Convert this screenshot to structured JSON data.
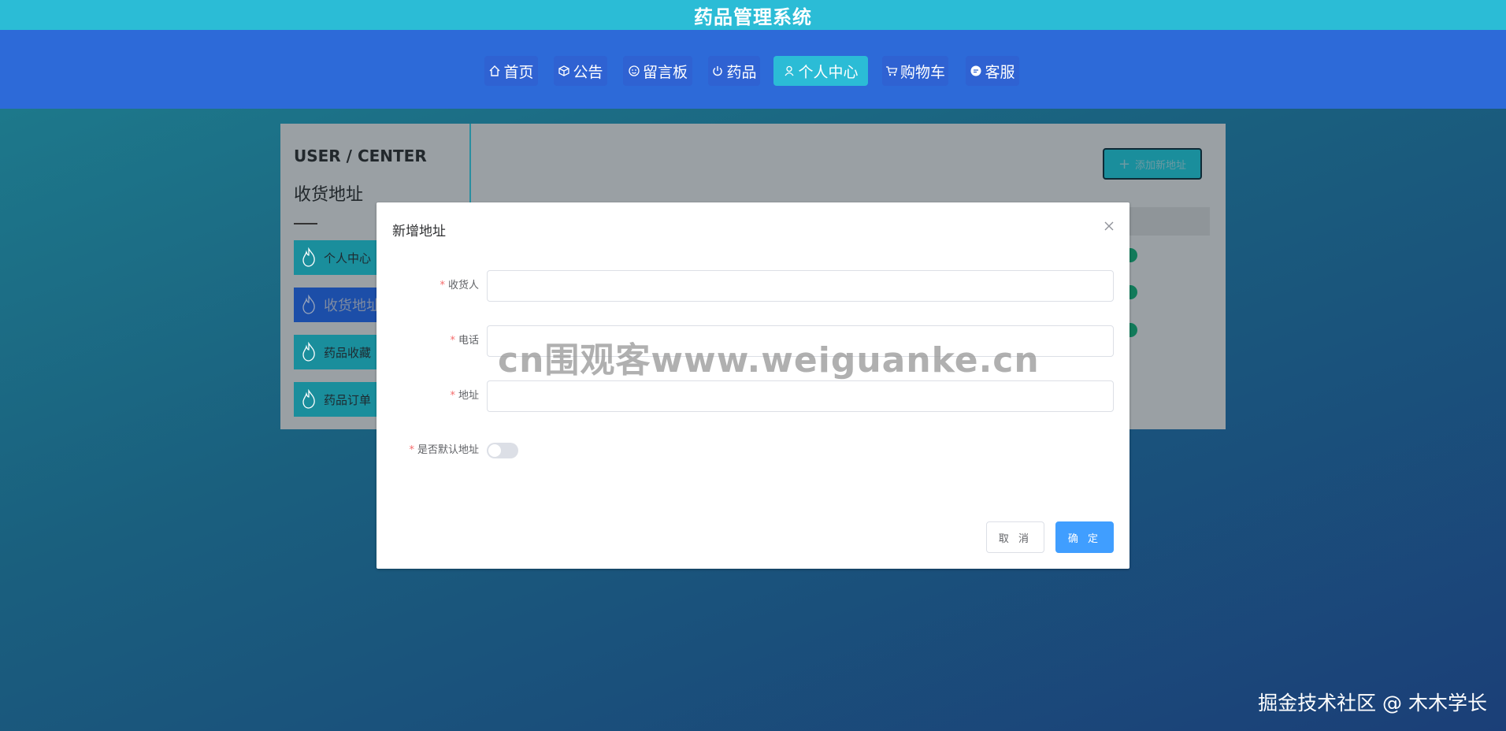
{
  "app": {
    "title": "药品管理系统"
  },
  "nav": {
    "items": [
      {
        "label": "首页",
        "icon": "home-icon"
      },
      {
        "label": "公告",
        "icon": "box-icon"
      },
      {
        "label": "留言板",
        "icon": "smile-icon"
      },
      {
        "label": "药品",
        "icon": "power-icon"
      },
      {
        "label": "个人中心",
        "icon": "user-icon",
        "active": true
      },
      {
        "label": "购物车",
        "icon": "cart-icon"
      },
      {
        "label": "客服",
        "icon": "chat-icon"
      }
    ]
  },
  "sidebar": {
    "heading": "USER / CENTER",
    "subheading": "收货地址",
    "items": [
      {
        "label": "个人中心",
        "icon": "fire-icon"
      },
      {
        "label": "收货地址",
        "icon": "fire-icon",
        "selected": true
      },
      {
        "label": "药品收藏",
        "icon": "fire-icon"
      },
      {
        "label": "药品订单",
        "icon": "fire-icon"
      }
    ]
  },
  "content": {
    "add_button": "添加新地址"
  },
  "dialog": {
    "title": "新增地址",
    "fields": [
      {
        "label": "收货人",
        "value": "",
        "required": true
      },
      {
        "label": "电话",
        "value": "",
        "required": true
      },
      {
        "label": "地址",
        "value": "",
        "required": true
      },
      {
        "label": "是否默认地址",
        "type": "switch",
        "on": false,
        "required": true
      }
    ],
    "required_mark": "*",
    "cancel_label": "取 消",
    "confirm_label": "确 定"
  },
  "watermark": "cn围观客www.weiguanke.cn",
  "credit": "掘金技术社区 @ 木木学长",
  "colors": {
    "topbar": "#2bbcd6",
    "navbar": "#2d6ad8",
    "active_tab": "#2bbcd6",
    "primary_button": "#409eff",
    "required": "#f56c6c"
  }
}
